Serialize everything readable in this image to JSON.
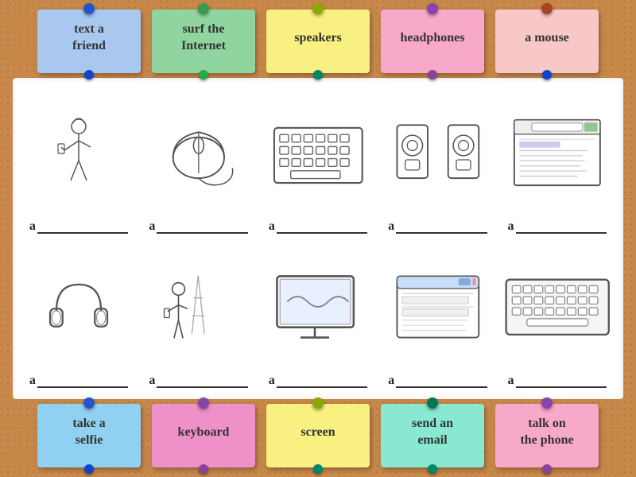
{
  "top_notes": [
    {
      "id": "text-a-friend",
      "label": "text a\nfriend",
      "color": "blue",
      "pin_color": "pin-blue"
    },
    {
      "id": "surf-internet",
      "label": "surf the\nInternet",
      "color": "green",
      "pin_color": "pin-green"
    },
    {
      "id": "speakers",
      "label": "speakers",
      "color": "yellow",
      "pin_color": "pin-teal"
    },
    {
      "id": "headphones",
      "label": "headphones",
      "color": "pink",
      "pin_color": "pin-purple"
    },
    {
      "id": "a-mouse",
      "label": "a mouse",
      "color": "peach",
      "pin_color": "pin-blue"
    }
  ],
  "bottom_notes": [
    {
      "id": "take-a-selfie",
      "label": "take a\nselfie",
      "color": "lightblue",
      "pin_color": "pin-blue"
    },
    {
      "id": "keyboard",
      "label": "keyboard",
      "color": "magenta",
      "pin_color": "pin-purple"
    },
    {
      "id": "screen",
      "label": "screen",
      "color": "yellow",
      "pin_color": "pin-teal"
    },
    {
      "id": "send-an-email",
      "label": "send an\nemail",
      "color": "mint",
      "pin_color": "pin-teal"
    },
    {
      "id": "talk-on-the-phone",
      "label": "talk on\nthe phone",
      "color": "pink",
      "pin_color": "pin-purple"
    }
  ],
  "images": [
    {
      "id": "person-texting",
      "answer_prefix": "a"
    },
    {
      "id": "mouse",
      "answer_prefix": "a"
    },
    {
      "id": "keyboard-top",
      "answer_prefix": "a"
    },
    {
      "id": "speakers-img",
      "answer_prefix": "a"
    },
    {
      "id": "browser",
      "answer_prefix": "a"
    },
    {
      "id": "headphones-img",
      "answer_prefix": "a"
    },
    {
      "id": "eiffel-selfie",
      "answer_prefix": "a"
    },
    {
      "id": "screen-img",
      "answer_prefix": "a"
    },
    {
      "id": "email-img",
      "answer_prefix": "a"
    },
    {
      "id": "keyboard-bottom",
      "answer_prefix": "a"
    }
  ]
}
